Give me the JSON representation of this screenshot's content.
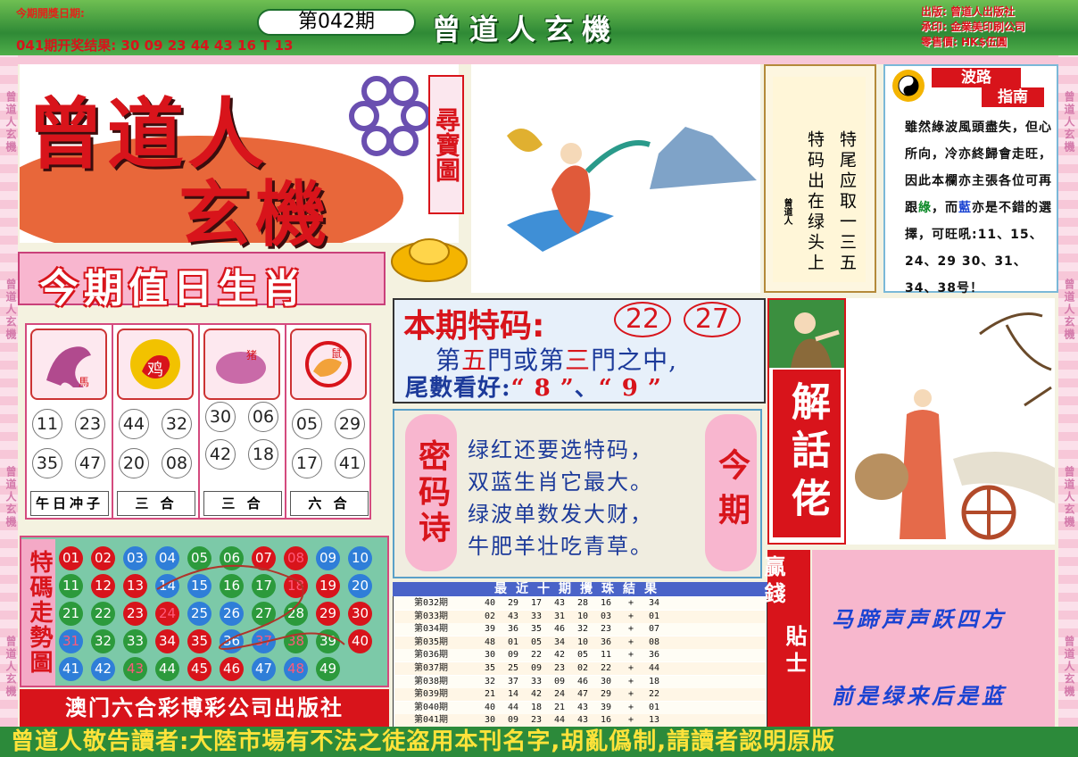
{
  "header": {
    "next_draw_label": "今期開獎日期:",
    "issue": "第042期",
    "last_result": "041期开奖结果: 30 09 23 44 43 16 T 13",
    "brand": "曾道人玄機",
    "publisher_lines": [
      "出版: 曾道人出版社",
      "承印: 金業美印刷公司",
      "零售價: HK$伍圓"
    ]
  },
  "border": {
    "repeat_text": "曾道人玄機"
  },
  "logo": {
    "line1": "曾道人",
    "line2": "玄機",
    "tag": "尋寶圖"
  },
  "zodiac": {
    "title": "今期值日生肖",
    "cells": [
      {
        "icon_label": "馬",
        "icon_name": "horse-icon",
        "numbers": [
          "11",
          "23",
          "35",
          "47"
        ],
        "label": "午日冲子"
      },
      {
        "icon_label": "鸡",
        "icon_name": "rooster-icon",
        "numbers": [
          "44",
          "32",
          "20",
          "08"
        ],
        "label": "三 合"
      },
      {
        "icon_label": "猪",
        "icon_name": "pig-icon",
        "numbers": [
          "30",
          "06",
          "42",
          "18"
        ],
        "label": "三 合"
      },
      {
        "icon_label": "鼠",
        "icon_name": "rat-icon",
        "numbers": [
          "05",
          "29",
          "17",
          "41"
        ],
        "label": "六 合"
      }
    ]
  },
  "trend": {
    "label": "特碼走勢圖",
    "balls": [
      {
        "n": "01",
        "c": "red"
      },
      {
        "n": "02",
        "c": "red"
      },
      {
        "n": "03",
        "c": "blue"
      },
      {
        "n": "04",
        "c": "blue"
      },
      {
        "n": "05",
        "c": "green"
      },
      {
        "n": "06",
        "c": "green"
      },
      {
        "n": "07",
        "c": "red"
      },
      {
        "n": "08",
        "c": "red",
        "hl": true
      },
      {
        "n": "09",
        "c": "blue"
      },
      {
        "n": "10",
        "c": "blue"
      },
      {
        "n": "11",
        "c": "green"
      },
      {
        "n": "12",
        "c": "red"
      },
      {
        "n": "13",
        "c": "red"
      },
      {
        "n": "14",
        "c": "blue"
      },
      {
        "n": "15",
        "c": "blue"
      },
      {
        "n": "16",
        "c": "green"
      },
      {
        "n": "17",
        "c": "green"
      },
      {
        "n": "18",
        "c": "red",
        "hl": true
      },
      {
        "n": "19",
        "c": "red"
      },
      {
        "n": "20",
        "c": "blue"
      },
      {
        "n": "21",
        "c": "green"
      },
      {
        "n": "22",
        "c": "green"
      },
      {
        "n": "23",
        "c": "red"
      },
      {
        "n": "24",
        "c": "red",
        "hl": true
      },
      {
        "n": "25",
        "c": "blue"
      },
      {
        "n": "26",
        "c": "blue"
      },
      {
        "n": "27",
        "c": "green"
      },
      {
        "n": "28",
        "c": "green"
      },
      {
        "n": "29",
        "c": "red"
      },
      {
        "n": "30",
        "c": "red"
      },
      {
        "n": "31",
        "c": "blue",
        "hl": true
      },
      {
        "n": "32",
        "c": "green"
      },
      {
        "n": "33",
        "c": "green"
      },
      {
        "n": "34",
        "c": "red"
      },
      {
        "n": "35",
        "c": "red"
      },
      {
        "n": "36",
        "c": "blue"
      },
      {
        "n": "37",
        "c": "blue",
        "hl": true
      },
      {
        "n": "38",
        "c": "green",
        "hl": true
      },
      {
        "n": "39",
        "c": "green"
      },
      {
        "n": "40",
        "c": "red"
      },
      {
        "n": "41",
        "c": "blue"
      },
      {
        "n": "42",
        "c": "blue"
      },
      {
        "n": "43",
        "c": "green",
        "hl": true
      },
      {
        "n": "44",
        "c": "green"
      },
      {
        "n": "45",
        "c": "red"
      },
      {
        "n": "46",
        "c": "red"
      },
      {
        "n": "47",
        "c": "blue"
      },
      {
        "n": "48",
        "c": "blue",
        "hl": true
      },
      {
        "n": "49",
        "c": "green"
      }
    ]
  },
  "publisher_banner": "澳门六合彩博彩公司出版社",
  "bottom_notice": "曾道人敬告讀者:大陸市場有不法之徒盗用本刊名字,胡亂僞制,請讀者認明原版",
  "tip": {
    "col1": "特尾应取一三五",
    "col2": "特码出在绿头上",
    "sign": "曾道人"
  },
  "wave": {
    "title1": "波路",
    "title2": "指南",
    "text_a": "雖然綠波風頭盡失，但心所向，冷亦終歸會走旺，因此本欄亦主張各位可再跟",
    "green_word": "綠",
    "mid": "，而",
    "blue_word": "藍",
    "text_b": "亦是不錯的選擇，可旺吼:",
    "numbers": "11、15、24、29  30、31、34、38号！"
  },
  "special": {
    "title": "本期特码:",
    "nums": [
      "22",
      "27"
    ],
    "door_a": "第",
    "door_b": "五",
    "door_c": "門或第",
    "door_d": "三",
    "door_e": "門之中,",
    "tail_a": "尾數看好:",
    "tail_b": "“ 8 ”",
    "tail_c": "、",
    "tail_d": "“ 9 ”"
  },
  "poem": {
    "left_label": "密码诗",
    "right_label": "今期",
    "lines": [
      "绿红还要选特码，",
      "双蓝生肖它最大。",
      "绿波单数发大财，",
      "牛肥羊壮吃青草。"
    ]
  },
  "history": {
    "title": "最近十期攪珠結果",
    "rows": [
      {
        "p": "第032期",
        "v": [
          "40",
          "29",
          "17",
          "43",
          "28",
          "16",
          "+",
          "34"
        ]
      },
      {
        "p": "第033期",
        "v": [
          "02",
          "43",
          "33",
          "31",
          "10",
          "03",
          "+",
          "01"
        ]
      },
      {
        "p": "第034期",
        "v": [
          "39",
          "36",
          "35",
          "46",
          "32",
          "23",
          "+",
          "07"
        ]
      },
      {
        "p": "第035期",
        "v": [
          "48",
          "01",
          "05",
          "34",
          "10",
          "36",
          "+",
          "08"
        ]
      },
      {
        "p": "第036期",
        "v": [
          "30",
          "09",
          "22",
          "42",
          "05",
          "11",
          "+",
          "36"
        ]
      },
      {
        "p": "第037期",
        "v": [
          "35",
          "25",
          "09",
          "23",
          "02",
          "22",
          "+",
          "44"
        ]
      },
      {
        "p": "第038期",
        "v": [
          "32",
          "37",
          "33",
          "09",
          "46",
          "30",
          "+",
          "18"
        ]
      },
      {
        "p": "第039期",
        "v": [
          "21",
          "14",
          "42",
          "24",
          "47",
          "29",
          "+",
          "22"
        ]
      },
      {
        "p": "第040期",
        "v": [
          "40",
          "44",
          "18",
          "21",
          "43",
          "39",
          "+",
          "01"
        ]
      },
      {
        "p": "第041期",
        "v": [
          "30",
          "09",
          "23",
          "44",
          "43",
          "16",
          "+",
          "13"
        ]
      }
    ]
  },
  "jiehua": {
    "label": "解話佬"
  },
  "winning": {
    "left": "贏錢",
    "right": "貼士"
  },
  "verse": {
    "line1": "马蹄声声跃四方",
    "line2": "前是绿来后是蓝"
  }
}
